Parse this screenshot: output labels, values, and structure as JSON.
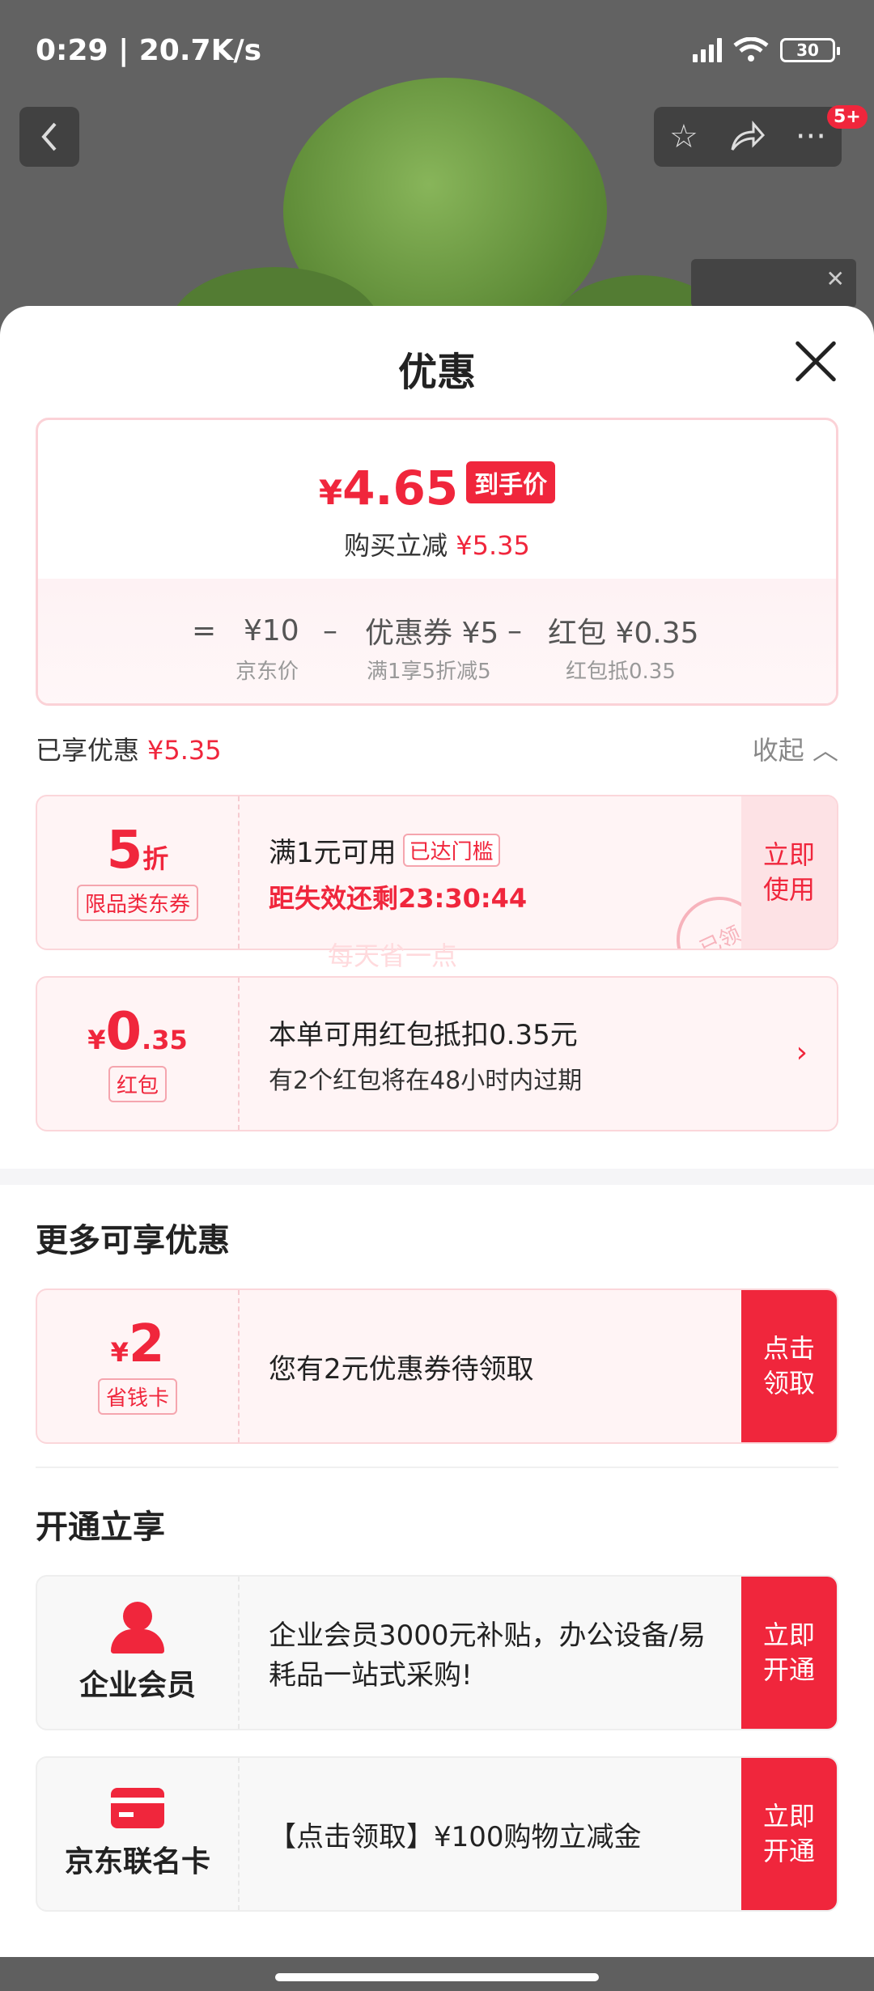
{
  "status_bar": {
    "time_speed": "0:29 | 20.7K/s",
    "battery": "30",
    "network_badge": "5+"
  },
  "sheet": {
    "title": "优惠"
  },
  "price": {
    "currency": "¥",
    "amount": "4.65",
    "tag": "到手价",
    "save_label": "购买立减",
    "save_value": "¥5.35",
    "calc": {
      "eq": "=",
      "jd_price": "¥10",
      "minus1": "–",
      "coupon": "优惠券 ¥5",
      "minus2": "–",
      "redpacket": "红包 ¥0.35",
      "jd_price_label": "京东价",
      "coupon_label": "满1享5折减5",
      "redpacket_label": "红包抵0.35"
    }
  },
  "enjoyed": {
    "label": "已享优惠",
    "value": "¥5.35",
    "collapse": "收起"
  },
  "coupon_card": {
    "value": "5",
    "unit": "折",
    "pill": "限品类东券",
    "line1": "满1元可用",
    "threshold": "已达门槛",
    "line2": "距失效还剩23:30:44",
    "button": "立即使用",
    "stamp": "已领"
  },
  "watermark": "每天省一点",
  "redpacket_card": {
    "currency": "¥",
    "value_int": "0",
    "value_dec": ".35",
    "pill": "红包",
    "line1": "本单可用红包抵扣0.35元",
    "line2": "有2个红包将在48小时内过期"
  },
  "more": {
    "title": "更多可享优惠",
    "card": {
      "currency": "¥",
      "value": "2",
      "pill": "省钱卡",
      "text": "您有2元优惠券待领取",
      "button": "点击领取"
    }
  },
  "open": {
    "title": "开通立享",
    "enterprise": {
      "name": "企业会员",
      "text": "企业会员3000元补贴，办公设备/易耗品一站式采购!",
      "button": "立即开通"
    },
    "cobrand": {
      "name": "京东联名卡",
      "text": "【点击领取】¥100购物立减金",
      "button": "立即开通"
    }
  },
  "colors": {
    "accent": "#f0263c",
    "light_pink": "#fff4f5"
  }
}
